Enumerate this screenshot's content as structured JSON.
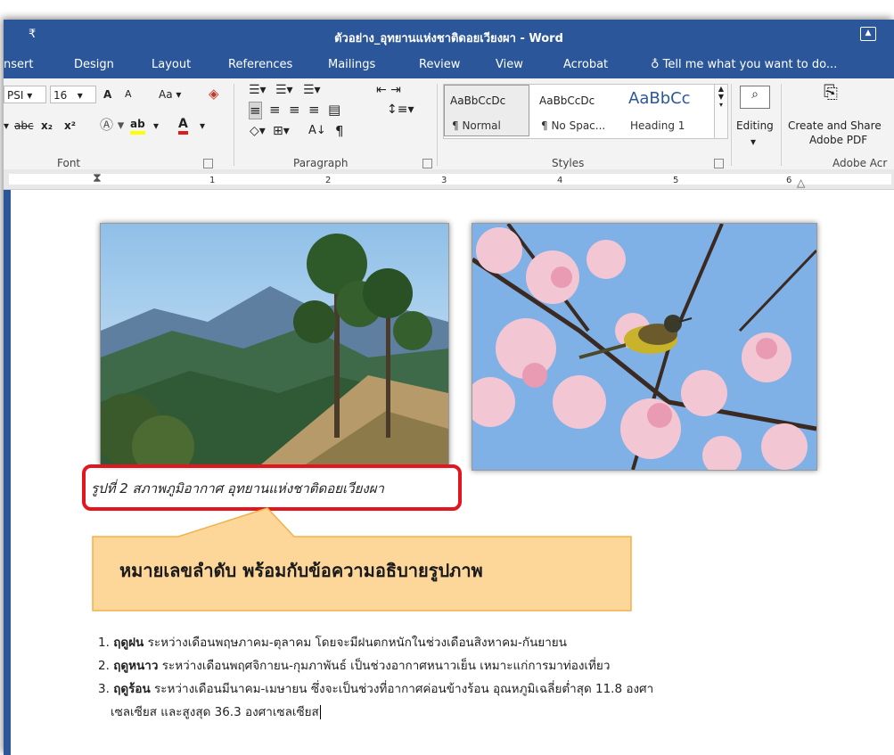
{
  "window": {
    "title": "ตัวอย่าง_อุทยานแห่งชาติดอยเวียงผา - Word",
    "quick_access": "₹"
  },
  "tabs": [
    "nsert",
    "Design",
    "Layout",
    "References",
    "Mailings",
    "Review",
    "View",
    "Acrobat"
  ],
  "tell_me": "Tell me what you want to do...",
  "ribbon": {
    "font": {
      "font_name": "PSI",
      "font_size": "16",
      "grow": "A",
      "shrink": "A",
      "change_case": "Aa",
      "strike": "abc",
      "subscript": "x₂",
      "superscript": "x²",
      "label": "Font"
    },
    "paragraph": {
      "label": "Paragraph"
    },
    "styles": {
      "label": "Styles",
      "items": [
        {
          "sample": "AaBbCcDc",
          "name": "¶ Normal"
        },
        {
          "sample": "AaBbCcDc",
          "name": "¶ No Spac..."
        },
        {
          "sample": "AaBbCc",
          "name": "Heading 1"
        }
      ]
    },
    "editing": {
      "label": "Editing"
    },
    "acrobat": {
      "label": "Create and Share Adobe PDF",
      "line1": "Create and Share",
      "line2": "Adobe PDF",
      "group": "Adobe Acr"
    }
  },
  "ruler": [
    "1",
    "2",
    "3",
    "4",
    "5",
    "6"
  ],
  "document": {
    "caption": "รูปที่ 2 สภาพภูมิอากาศ อุทยานแห่งชาติดอยเวียงผา",
    "callout": "หมายเลขลำดับ พร้อมกับข้อความอธิบายรูปภาพ",
    "list": [
      {
        "num": "1.",
        "term": "ฤดูฝน",
        "text": "ระหว่างเดือนพฤษภาคม-ตุลาคม โดยจะมีฝนตกหนักในช่วงเดือนสิงหาคม-กันยายน"
      },
      {
        "num": "2.",
        "term": "ฤดูหนาว",
        "text": "ระหว่างเดือนพฤศจิกายน-กุมภาพันธ์ เป็นช่วงอากาศหนาวเย็น เหมาะแก่การมาท่องเที่ยว"
      },
      {
        "num": "3.",
        "term": "ฤดูร้อน",
        "text": "ระหว่างเดือนมีนาคม-เมษายน ซึ่งจะเป็นช่วงที่อากาศค่อนข้างร้อน อุณหภูมิเฉลี่ยต่ำสุด 11.8 องศา",
        "cont": "เซลเซียส และสูงสุด 36.3 องศาเซลเซียส"
      }
    ]
  },
  "colors": {
    "word_blue": "#2b579a",
    "highlight_red": "#e3161f",
    "callout_fill": "#fdd79a"
  }
}
